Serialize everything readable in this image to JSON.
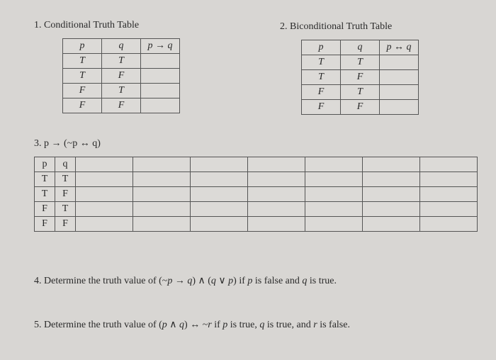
{
  "s1": {
    "title": "1. Conditional Truth Table",
    "h1": "p",
    "h2": "q",
    "h3": "p → q",
    "rows": [
      {
        "p": "T",
        "q": "T",
        "r": ""
      },
      {
        "p": "T",
        "q": "F",
        "r": ""
      },
      {
        "p": "F",
        "q": "T",
        "r": ""
      },
      {
        "p": "F",
        "q": "F",
        "r": ""
      }
    ]
  },
  "s2": {
    "title": "2. Biconditional Truth Table",
    "h1": "p",
    "h2": "q",
    "h3": "p ↔ q",
    "rows": [
      {
        "p": "T",
        "q": "T",
        "r": ""
      },
      {
        "p": "T",
        "q": "F",
        "r": ""
      },
      {
        "p": "F",
        "q": "T",
        "r": ""
      },
      {
        "p": "F",
        "q": "F",
        "r": ""
      }
    ]
  },
  "s3": {
    "title": "3. p → (~p ↔ q)",
    "h1": "p",
    "h2": "q",
    "rows": [
      {
        "p": "T",
        "q": "T"
      },
      {
        "p": "T",
        "q": "F"
      },
      {
        "p": "F",
        "q": "T"
      },
      {
        "p": "F",
        "q": "F"
      }
    ]
  },
  "s4": {
    "text_a": "4. Determine the truth value of (~",
    "text_b": "p",
    "text_c": " → ",
    "text_d": "q",
    "text_e": ") ∧ (",
    "text_f": "q",
    "text_g": " ∨ ",
    "text_h": "p",
    "text_i": ") if ",
    "text_j": "p",
    "text_k": " is false and ",
    "text_l": "q",
    "text_m": " is true."
  },
  "s5": {
    "text_a": "5. Determine the truth value of (",
    "text_b": "p",
    "text_c": " ∧ ",
    "text_d": "q",
    "text_e": ") ↔ ~",
    "text_f": "r",
    "text_g": " if ",
    "text_h": "p",
    "text_i": " is true, ",
    "text_j": "q",
    "text_k": " is true, and ",
    "text_l": "r",
    "text_m": " is false."
  }
}
